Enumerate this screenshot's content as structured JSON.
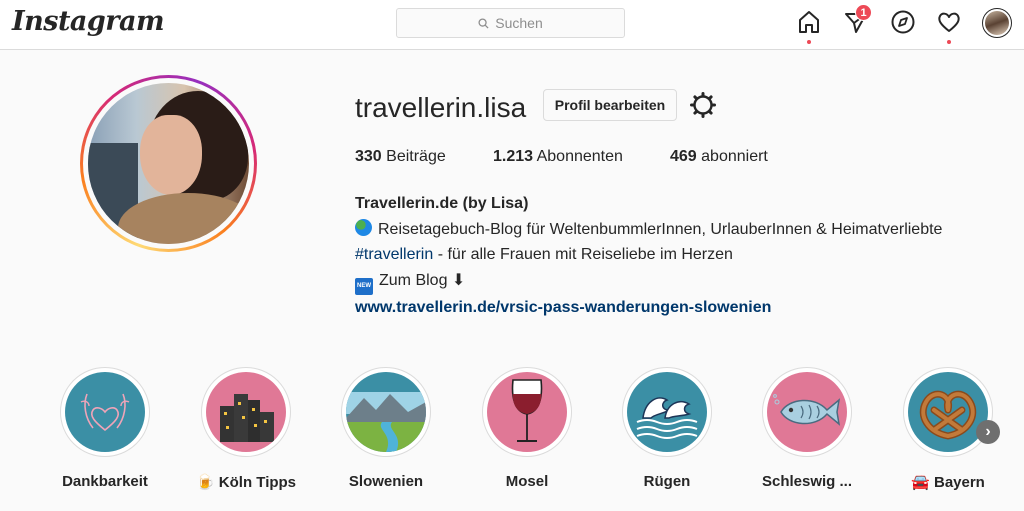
{
  "app": {
    "logo": "Instagram"
  },
  "search": {
    "placeholder": "Suchen"
  },
  "nav": {
    "icons": [
      "home-icon",
      "direct-icon",
      "explore-icon",
      "activity-icon",
      "avatar"
    ],
    "direct_badge": "1"
  },
  "profile": {
    "username": "travellerin.lisa",
    "edit_label": "Profil bearbeiten",
    "stats": [
      {
        "count": "330",
        "label": "Beiträge"
      },
      {
        "count": "1.213",
        "label": "Abonnenten"
      },
      {
        "count": "469",
        "label": "abonniert"
      }
    ],
    "bio": {
      "name": "Travellerin.de (by Lisa)",
      "line1": "Reisetagebuch-Blog für WeltenbummlerInnen, UrlauberInnen & Heimatverliebte",
      "hashtag": "#travellerin",
      "line2_rest": " - für alle Frauen mit Reiseliebe im Herzen",
      "line3": "Zum Blog ⬇",
      "new_icon": "NEW",
      "link": "www.travellerin.de/vrsic-pass-wanderungen-slowenien"
    }
  },
  "highlights": [
    {
      "label": "Dankbarkeit",
      "bg": "#3b8fa5"
    },
    {
      "label": "🍺 Köln Tipps",
      "bg": "#e07896"
    },
    {
      "label": "Slowenien",
      "bg": "#3b8fa5"
    },
    {
      "label": "Mosel",
      "bg": "#e07896"
    },
    {
      "label": "Rügen",
      "bg": "#3b8fa5"
    },
    {
      "label": "Schleswig ...",
      "bg": "#e07896"
    },
    {
      "label": "🚘 Bayern",
      "bg": "#3b8fa5"
    }
  ],
  "colors": {
    "accent_link": "#00376b",
    "notification": "#ed4956",
    "teal": "#3b8fa5",
    "pink": "#e07896"
  }
}
